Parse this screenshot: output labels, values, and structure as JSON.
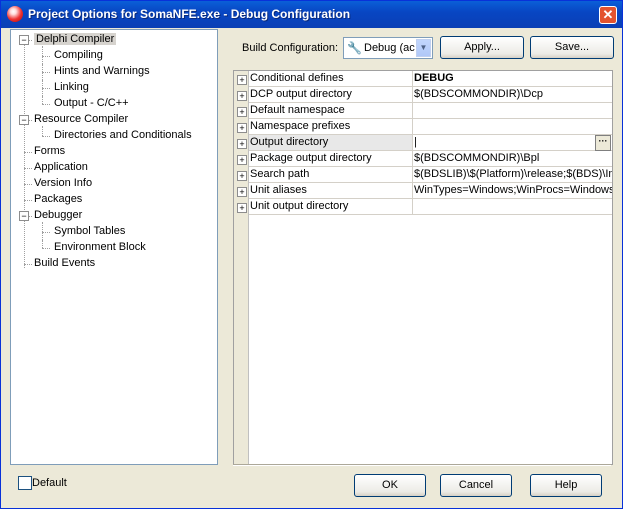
{
  "window": {
    "title": "Project Options for SomaNFE.exe - Debug Configuration",
    "close_glyph": "✕"
  },
  "tree": {
    "items": [
      {
        "label": "Delphi Compiler",
        "level": 0,
        "expanded": true,
        "selected": true
      },
      {
        "label": "Compiling",
        "level": 1
      },
      {
        "label": "Hints and Warnings",
        "level": 1
      },
      {
        "label": "Linking",
        "level": 1
      },
      {
        "label": "Output - C/C++",
        "level": 1
      },
      {
        "label": "Resource Compiler",
        "level": 0,
        "expanded": true
      },
      {
        "label": "Directories and Conditionals",
        "level": 1
      },
      {
        "label": "Forms",
        "level": 0
      },
      {
        "label": "Application",
        "level": 0
      },
      {
        "label": "Version Info",
        "level": 0
      },
      {
        "label": "Packages",
        "level": 0
      },
      {
        "label": "Debugger",
        "level": 0,
        "expanded": true
      },
      {
        "label": "Symbol Tables",
        "level": 1
      },
      {
        "label": "Environment Block",
        "level": 1
      },
      {
        "label": "Build Events",
        "level": 0
      }
    ]
  },
  "build_config": {
    "label": "Build Configuration:",
    "selected": "Debug (ac",
    "icon": "wrench-icon"
  },
  "buttons": {
    "apply": "Apply...",
    "save": "Save...",
    "ok": "OK",
    "cancel": "Cancel",
    "help": "Help"
  },
  "properties": [
    {
      "name": "Conditional defines",
      "value": "DEBUG",
      "bold": true
    },
    {
      "name": "DCP output directory",
      "value": "$(BDSCOMMONDIR)\\Dcp"
    },
    {
      "name": "Default namespace",
      "value": ""
    },
    {
      "name": "Namespace prefixes",
      "value": ""
    },
    {
      "name": "Output directory",
      "value": "|",
      "editing": true
    },
    {
      "name": "Package output directory",
      "value": "$(BDSCOMMONDIR)\\Bpl"
    },
    {
      "name": "Search path",
      "value": "$(BDSLIB)\\$(Platform)\\release;$(BDS)\\Im"
    },
    {
      "name": "Unit aliases",
      "value": "WinTypes=Windows;WinProcs=Windows"
    },
    {
      "name": "Unit output directory",
      "value": ""
    }
  ],
  "default_checkbox": {
    "label": "Default",
    "checked": false
  }
}
